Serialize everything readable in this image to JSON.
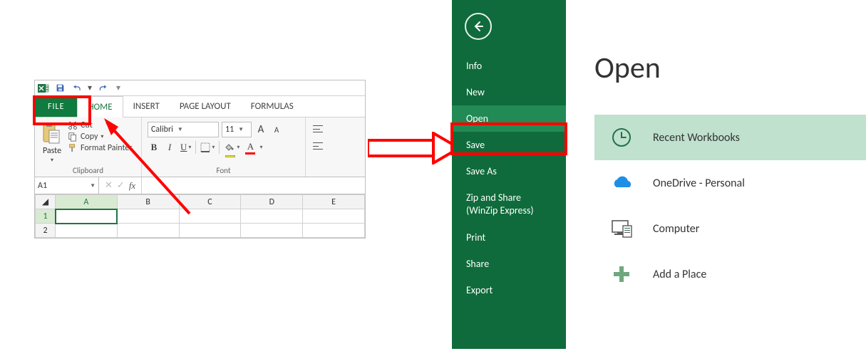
{
  "qat": {
    "save_tip": "Save",
    "undo_tip": "Undo",
    "redo_tip": "Redo"
  },
  "tabs": {
    "file": "FILE",
    "home": "HOME",
    "insert": "INSERT",
    "page_layout": "PAGE LAYOUT",
    "formulas": "FORMULAS"
  },
  "clipboard": {
    "paste": "Paste",
    "cut": "Cut",
    "copy": "Copy",
    "format_painter": "Format Painter",
    "group_label": "Clipboard"
  },
  "font": {
    "name": "Calibri",
    "size": "11",
    "group_label": "Font",
    "bold": "B",
    "italic": "I",
    "underline": "U",
    "grow": "A",
    "shrink": "A",
    "color_letter": "A"
  },
  "namebox": {
    "ref": "A1",
    "fx": "fx"
  },
  "columns": [
    "A",
    "B",
    "C",
    "D",
    "E"
  ],
  "rows": [
    "1",
    "2"
  ],
  "backstage": {
    "title": "Open",
    "nav": {
      "info": "Info",
      "new": "New",
      "open": "Open",
      "save": "Save",
      "save_as": "Save As",
      "zip_line1": "Zip and Share",
      "zip_line2": "(WinZip Express)",
      "print": "Print",
      "share": "Share",
      "export": "Export"
    },
    "places": {
      "recent": "Recent Workbooks",
      "onedrive": "OneDrive - Personal",
      "computer": "Computer",
      "add_place": "Add a Place"
    }
  }
}
